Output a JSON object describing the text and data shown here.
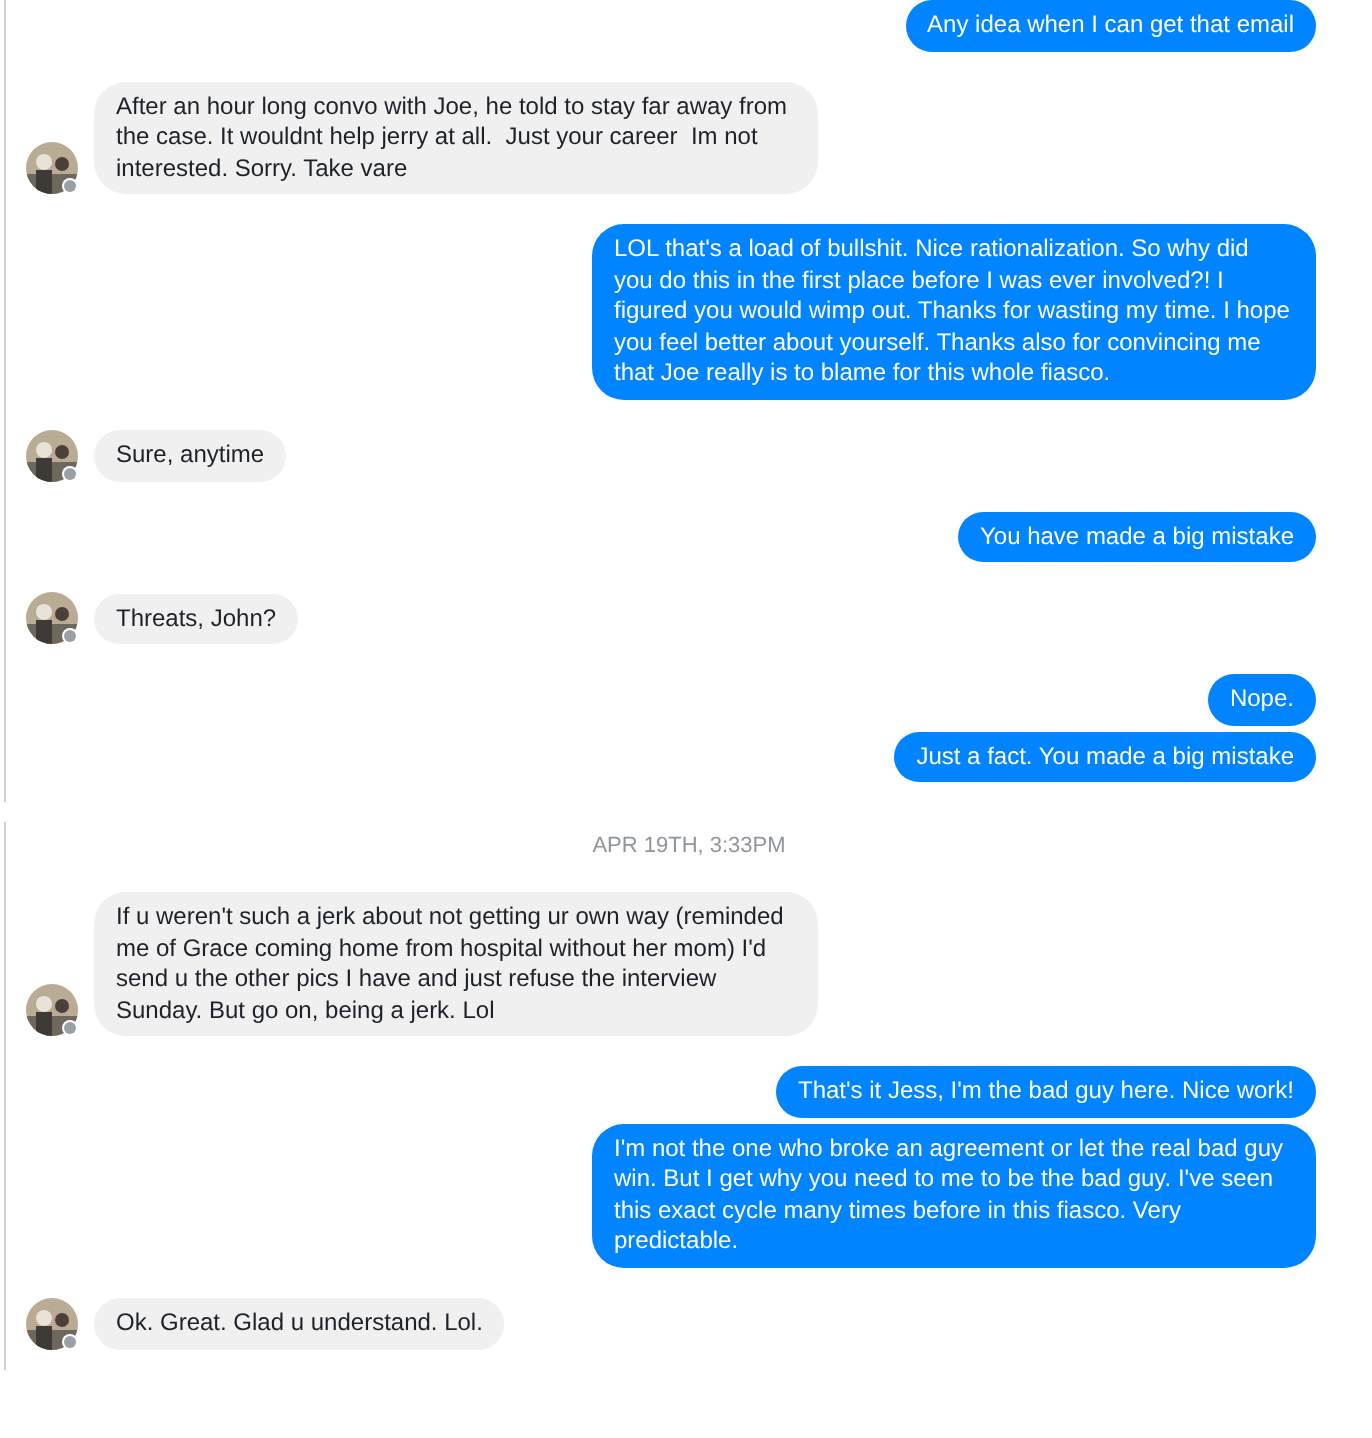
{
  "panels": [
    {
      "messages": [
        {
          "kind": "outgoing",
          "text": "Any idea when I can get that email"
        },
        {
          "kind": "incoming",
          "text": "After an hour long convo with Joe, he told to stay far away from the case. It wouldnt help jerry at all.  Just your career  Im not interested. Sorry. Take vare"
        },
        {
          "kind": "outgoing",
          "text": "LOL that's a load of bullshit. Nice rationalization. So why did you do this in the first place before I was ever involved?! I figured you would wimp out. Thanks for wasting my time. I hope you feel better about yourself. Thanks also for convincing me that Joe really is to blame for this whole fiasco."
        },
        {
          "kind": "incoming",
          "text": "Sure, anytime"
        },
        {
          "kind": "outgoing",
          "text": "You have made a big mistake"
        },
        {
          "kind": "incoming",
          "text": "Threats, John?"
        },
        {
          "kind": "outgoing",
          "text": "Nope."
        },
        {
          "kind": "outgoing",
          "text": "Just a fact. You made a big mistake"
        }
      ]
    },
    {
      "messages": [
        {
          "kind": "timestamp",
          "text": "APR 19TH, 3:33PM"
        },
        {
          "kind": "incoming",
          "text": "If u weren't such a jerk about not getting ur own way (reminded me of Grace coming home from hospital without her mom) I'd send u the other pics I have and just refuse the interview Sunday. But go on, being a jerk. Lol"
        },
        {
          "kind": "outgoing",
          "text": "That's it Jess, I'm the bad guy here. Nice work!"
        },
        {
          "kind": "outgoing",
          "text": "I'm not the one who broke an agreement or let the real bad guy win. But I get why you need to me to be the bad guy. I've seen this exact cycle many times before in this fiasco. Very predictable."
        },
        {
          "kind": "incoming",
          "text": "Ok. Great. Glad u understand. Lol."
        }
      ]
    }
  ]
}
